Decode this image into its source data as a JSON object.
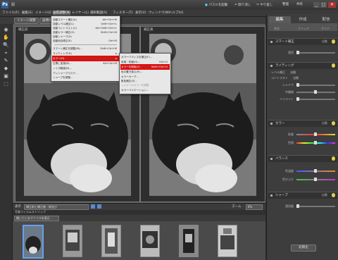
{
  "titlebar": {
    "app_title": "Ps",
    "tab_name": "開",
    "buttons": [
      "パスルを起動",
      "取り消し",
      "やり直し",
      "整理",
      "共有"
    ]
  },
  "menubar": {
    "items": [
      "ファイル(F)",
      "編集(E)",
      "イメージ(I)",
      "画質調整(N)",
      "レイヤー(L)",
      "選択範囲(S)",
      "フィルター(T)",
      "表示(V)",
      "ウィンドウ(W)",
      "ヘルプ(H)"
    ]
  },
  "optionsbar": {
    "buttons": [
      "イメージ調整",
      "画像比較"
    ]
  },
  "tools": [
    "◉",
    "✋",
    "🔍",
    "⌖",
    "✎",
    "◆",
    "▣",
    "⬚"
  ],
  "workspace": {
    "before_label": "補正前",
    "after_label": "補正後"
  },
  "statusbar": {
    "view_label": "表示",
    "view_value": "補正前と補正後 - 縦並び",
    "zoom_label": "ズーム",
    "zoom_value": "8%"
  },
  "bin": {
    "header": "写真フィルムストリップ",
    "dropdown": "開いているファイルを表示"
  },
  "dropdown_menu": {
    "items": [
      {
        "label": "自動スマート補正(A)",
        "shortcut": "Alt+Ctrl+M"
      },
      {
        "label": "自動レベル補正(L)",
        "shortcut": "Shift+Ctrl+L"
      },
      {
        "label": "自動コントラスト(C)",
        "shortcut": "Alt+Shift+Ctrl+L"
      },
      {
        "label": "自動カラー補正(O)",
        "shortcut": "Shift+Ctrl+B"
      },
      {
        "label": "自動シャープ(U)",
        "shortcut": ""
      },
      {
        "label": "自動赤目修正(E)",
        "shortcut": "Ctrl+R"
      },
      {
        "label": "スマート補正を調整(M)...",
        "shortcut": "Shift+Ctrl+M"
      },
      {
        "label": "ライティング(H)",
        "shortcut": ""
      },
      {
        "label": "カラー(O)",
        "shortcut": ""
      },
      {
        "label": "白黒に変換(B)...",
        "shortcut": "Alt+Ctrl+B"
      },
      {
        "label": "ノイズ軽減(N)...",
        "shortcut": ""
      },
      {
        "label": "アンシャープマスク...",
        "shortcut": ""
      },
      {
        "label": "シャープを調整...",
        "shortcut": ""
      }
    ]
  },
  "submenu": {
    "items": [
      {
        "label": "カラーバランスを補正(F)...",
        "shortcut": ""
      },
      {
        "label": "色相・彩度(H)...",
        "shortcut": "Ctrl+U"
      },
      {
        "label": "カラーを削除(V)",
        "shortcut": "Shift+Ctrl+U"
      },
      {
        "label": "色の置き換え(R)...",
        "shortcut": ""
      },
      {
        "label": "カラーカーブ...",
        "shortcut": ""
      },
      {
        "label": "肌色補正(S)...",
        "shortcut": ""
      },
      {
        "label": "レイヤーのカラーを調整",
        "shortcut": ""
      },
      {
        "label": "カラーバリエーション...",
        "shortcut": ""
      }
    ]
  },
  "panel": {
    "tabs": [
      "編集",
      "作成",
      "配信"
    ],
    "subtabs": [
      "完全",
      "クイック",
      "ガイド"
    ],
    "sections": [
      {
        "title": "スマート補正",
        "auto": "自動",
        "sliders": [
          "適用"
        ]
      },
      {
        "title": "ライティング",
        "auto": "",
        "sliders": [
          "シャドウ",
          "中間調",
          "ハイライト"
        ],
        "extras": [
          [
            "レベル補正",
            "自動"
          ],
          [
            "コントラスト",
            "自動"
          ]
        ]
      },
      {
        "title": "カラー",
        "auto": "自動",
        "sliders": [
          "彩度",
          "色相"
        ]
      },
      {
        "title": "バランス",
        "auto": "",
        "sliders": [
          "色温度",
          "色かぶり"
        ]
      },
      {
        "title": "シャープ",
        "auto": "自動",
        "sliders": [
          "適用量"
        ]
      }
    ],
    "reset_button": "初期化"
  },
  "colors": {
    "accent": "#cc1a1a",
    "menu_bg": "#e7e7e7",
    "panel_bg": "#3d3d3d"
  }
}
